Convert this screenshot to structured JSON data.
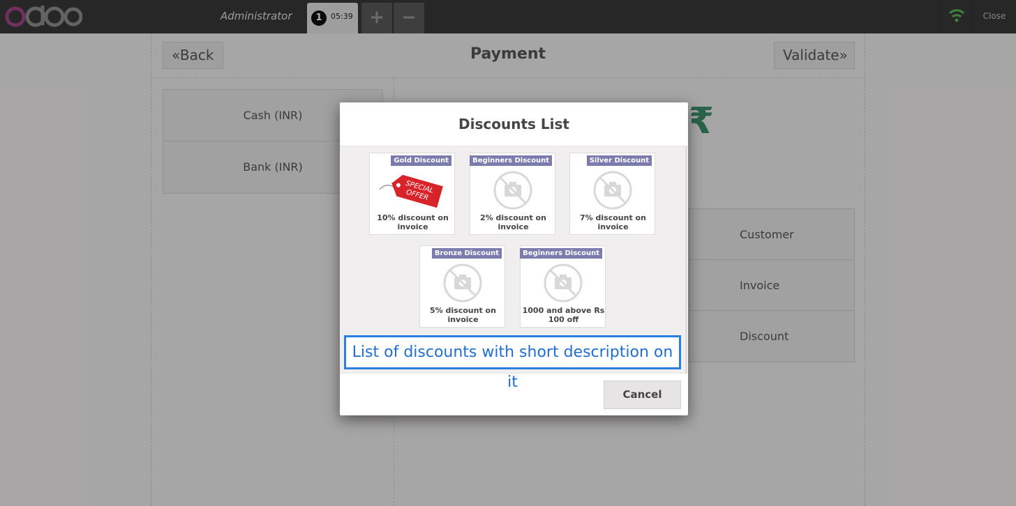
{
  "topbar": {
    "brand": "odoo",
    "cashier": "Administrator",
    "order_number": "1",
    "order_time": "05:39",
    "add_order_label": "+",
    "remove_order_label": "−",
    "close_label": "Close",
    "wifi_icon": "wifi-icon",
    "wifi_color": "#5cb85c"
  },
  "payment": {
    "back_label": "«Back",
    "title": "Payment",
    "validate_label": "Validate»",
    "methods": [
      {
        "label": "Cash (INR)"
      },
      {
        "label": "Bank (INR)"
      }
    ],
    "currency_symbol": "₹",
    "actions": [
      {
        "label": "Customer"
      },
      {
        "label": "Invoice"
      },
      {
        "label": "Discount"
      }
    ]
  },
  "modal": {
    "title": "Discounts List",
    "discounts": [
      {
        "tag": "Gold Discount",
        "description": "10% discount on invoice",
        "image": "special-offer-tag-icon"
      },
      {
        "tag": "Beginners Discount",
        "description": "2% discount on invoice",
        "image": "no-image-icon"
      },
      {
        "tag": "Silver Discount",
        "description": "7% discount on invoice",
        "image": "no-image-icon"
      },
      {
        "tag": "Bronze Discount",
        "description": "5% discount on invoice",
        "image": "no-image-icon"
      },
      {
        "tag": "Beginners Discount",
        "description": "1000 and above Rs 100 off",
        "image": "no-image-icon"
      }
    ],
    "offer_text_line1": "SPECIAL",
    "offer_text_line2": "OFFER",
    "annotation": "List of discounts with short description on it",
    "cancel_label": "Cancel"
  },
  "colors": {
    "accent_tag": "#7c7bad",
    "rupee_green": "#3c8f6a",
    "annotation_blue": "#2a7de1",
    "offer_red": "#d9232a",
    "logo_purple": "#a24689"
  }
}
